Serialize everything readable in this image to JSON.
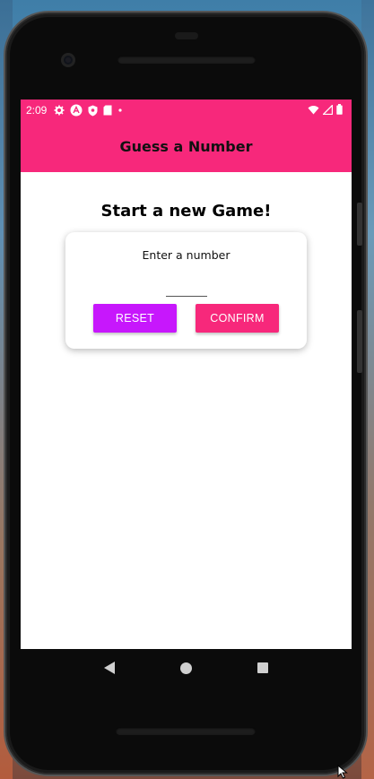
{
  "status_bar": {
    "time": "2:09",
    "left_icons": [
      "gear-icon",
      "android-a-icon",
      "shield-icon",
      "sd-card-icon",
      "dot-icon"
    ],
    "right_icons": [
      "wifi-icon",
      "signal-icon",
      "battery-icon"
    ]
  },
  "header": {
    "title": "Guess a Number"
  },
  "main": {
    "title": "Start a new Game!",
    "card": {
      "label": "Enter a number",
      "input_value": "",
      "reset_label": "RESET",
      "confirm_label": "CONFIRM"
    }
  },
  "nav": {
    "icons": [
      "back-icon",
      "home-icon",
      "recents-icon"
    ]
  },
  "colors": {
    "primary": "#f7287b",
    "accent": "#c717fc",
    "background": "#ffffff"
  }
}
